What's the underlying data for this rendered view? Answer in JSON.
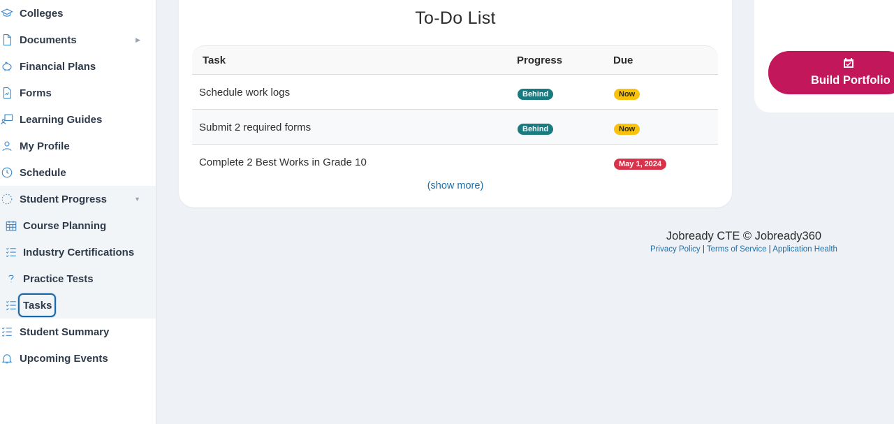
{
  "sidebar": {
    "items": [
      {
        "label": "Colleges",
        "icon": "graduation-cap-icon"
      },
      {
        "label": "Documents",
        "icon": "document-icon"
      },
      {
        "label": "Financial Plans",
        "icon": "piggy-bank-icon"
      },
      {
        "label": "Forms",
        "icon": "form-icon"
      },
      {
        "label": "Learning Guides",
        "icon": "learning-guide-icon"
      },
      {
        "label": "My Profile",
        "icon": "user-icon"
      },
      {
        "label": "Schedule",
        "icon": "clock-icon"
      },
      {
        "label": "Student Progress",
        "icon": "progress-icon"
      },
      {
        "label": "Course Planning",
        "icon": "calendar-grid-icon"
      },
      {
        "label": "Industry Certifications",
        "icon": "checklist-icon"
      },
      {
        "label": "Practice Tests",
        "icon": "question-icon"
      },
      {
        "label": "Tasks",
        "icon": "checklist-icon"
      },
      {
        "label": "Student Summary",
        "icon": "checklist-icon"
      },
      {
        "label": "Upcoming Events",
        "icon": "bell-icon"
      }
    ]
  },
  "todo": {
    "title": "To-Do List",
    "headers": {
      "task": "Task",
      "progress": "Progress",
      "due": "Due"
    },
    "rows": [
      {
        "task": "Schedule work logs",
        "progress": "Behind",
        "due": "Now"
      },
      {
        "task": "Submit 2 required forms",
        "progress": "Behind",
        "due": "Now"
      },
      {
        "task": "Complete 2 Best Works in Grade 10",
        "progress": "",
        "due": "May 1, 2024"
      }
    ],
    "show_more": "(show more)"
  },
  "portfolio": {
    "label": "Build Portfolio"
  },
  "footer": {
    "main": "Jobready CTE © Jobready360",
    "privacy": "Privacy Policy",
    "terms": "Terms of Service",
    "health": "Application Health",
    "separator": "|"
  },
  "colors": {
    "accent": "#3a89d0",
    "behind": "#197a80",
    "now": "#f8c20d",
    "late": "#d8334a",
    "portfolio": "#c2185b"
  }
}
